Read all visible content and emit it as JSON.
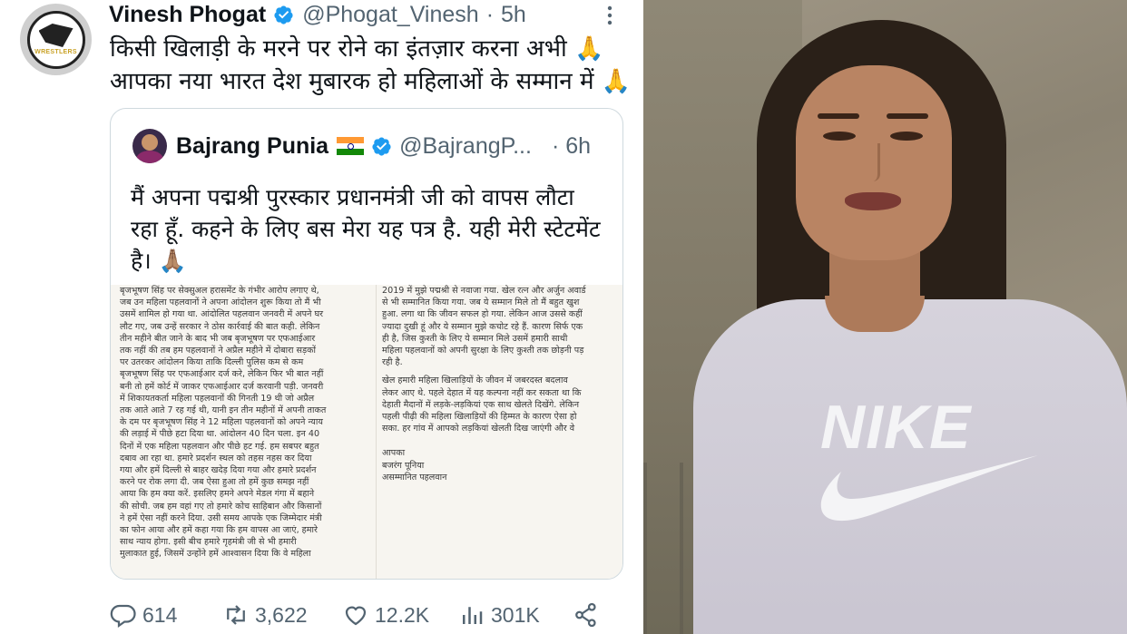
{
  "tweet": {
    "author_name": "Vinesh Phogat",
    "handle": "@Phogat_Vinesh",
    "separator": "·",
    "time": "5h",
    "avatar_label": "WRESTLERS",
    "text_lines": [
      "किसी खिलाड़ी के मरने पर रोने का इंतज़ार करना अभी 🙏",
      "आपका नया भारत देश मुबारक हो महिलाओं के सम्मान में  🙏"
    ]
  },
  "quoted_tweet": {
    "author_name": "Bajrang Punia",
    "handle": "@BajrangP...",
    "time": "· 6h",
    "text_lines": [
      "मैं अपना पद्मश्री पुरस्कार प्रधानमंत्री जी को वापस लौटा",
      "रहा हूँ. कहने के लिए बस मेरा यह पत्र है. यही मेरी स्टेटमेंट",
      "है। 🙏🏽"
    ],
    "letter": {
      "left_page": [
        "बृजभूषण सिंह पर सेक्सुअल हरासमेंट के गंभीर आरोप लगाए थे,",
        "जब उन महिला पहलवानों ने अपना आंदोलन शुरू किया तो मैं भी",
        "उसमें शामिल हो गया था. आंदोलित पहलवान जनवरी में अपने घर",
        "लौट गए, जब उन्हें सरकार ने ठोस कार्रवाई की बात कही. लेकिन",
        "तीन महीने बीत जाने के बाद भी जब बृजभूषण पर एफआईआर",
        "तक नहीं की तब हम पहलवानों ने अप्रैल महीने में दोबारा सड़कों",
        "पर उतरकर आंदोलन किया ताकि दिल्ली पुलिस कम से कम",
        "बृजभूषण सिंह पर एफआईआर दर्ज करे, लेकिन फिर भी बात नहीं",
        "बनी तो हमें कोर्ट में जाकर एफआईआर दर्ज करवानी पड़ी. जनवरी",
        "में शिकायतकर्ता महिला पहलवानों की गिनती 19 थी जो अप्रैल",
        "तक आते आते 7 रह गई थी, यानी इन तीन महीनों में अपनी ताकत",
        "के दम पर बृजभूषण सिंह ने 12 महिला पहलवानों को अपने न्याय",
        "की लड़ाई में पीछे हटा दिया था. आंदोलन 40 दिन चला. इन 40",
        "दिनों में एक महिला पहलवान और पीछे हट गई. हम सबपर बहुत",
        "दबाव आ रहा था. हमारे प्रदर्शन स्थल को तहस नहस कर दिया",
        "गया और हमें दिल्ली से बाहर खदेड़ दिया गया और हमारे प्रदर्शन",
        "करने पर रोक लगा दी. जब ऐसा हुआ तो हमें कुछ समझ नहीं",
        "आया कि हम क्या करें. इसलिए हमने अपने मेडल गंगा में बहाने",
        "की सोची. जब हम वहां गए तो हमारे कोच साहिबान और किसानों",
        "ने हमें ऐसा नहीं करने दिया. उसी समय आपके एक जिम्मेदार मंत्री",
        "का फोन आया और हमें कहा गया कि हम वापस आ जाएं, हमारे",
        "साथ न्याय होगा. इसी बीच हमारे गृहमंत्री जी से भी हमारी",
        "मुलाकात हुई, जिसमें उन्होंने हमें आश्वासन दिया कि वे महिला"
      ],
      "right_page": [
        "2019 में मुझे पद्मश्री से नवाजा गया. खेल रत्न और अर्जुन अवार्ड",
        "से भी सम्मानित किया गया. जब ये सम्मान मिले तो मैं बहुत खुश",
        "हुआ. लगा था कि जीवन सफल हो गया. लेकिन आज उससे कहीं",
        "ज्यादा दुखी हूं और ये सम्मान मुझे कचोट रहे हैं. कारण सिर्फ एक",
        "ही है, जिस कुश्ती के लिए ये सम्मान मिले उसमें हमारी साथी",
        "महिला पहलवानों को अपनी सुरक्षा के लिए कुश्ती तक छोड़नी पड़",
        "रही है."
      ],
      "right_page_2": [
        "खेल हमारी महिला खिलाड़ियों के जीवन में जबरदस्त बदलाव",
        "लेकर आए थे. पहले देहात में यह कल्पना नहीं कर सकता था कि",
        "देहाती मैदानों में लड़के-लड़कियां एक साथ खेलते दिखेंगे. लेकिन",
        "पहली पीढ़ी की महिला खिलाड़ियों की हिम्मत के कारण ऐसा हो",
        "सका. हर गांव में आपको लड़कियां खेलती दिख जाएंगी और वे"
      ],
      "signature": [
        "आपका",
        "बजरंग पूनिया",
        "असम्मानित पहलवान"
      ]
    }
  },
  "actions": {
    "replies": "614",
    "retweets": "3,622",
    "likes": "12.2K",
    "views": "301K"
  },
  "photo": {
    "shirt_logo_text": "NIKE"
  },
  "colors": {
    "verified_blue": "#1d9bf0",
    "secondary_text": "#536471",
    "border": "#cfd9de"
  }
}
